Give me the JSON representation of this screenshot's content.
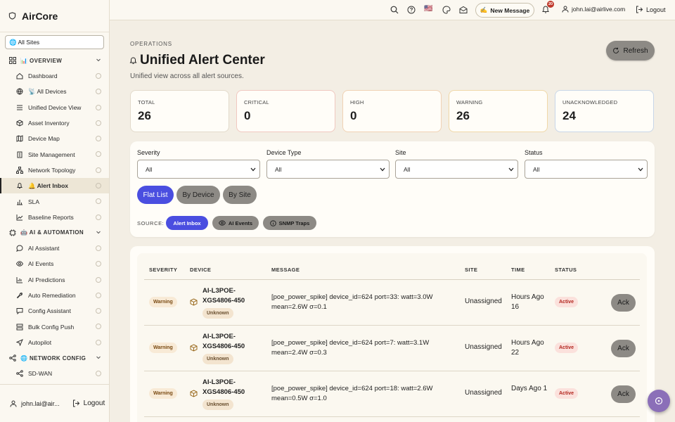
{
  "app": {
    "name": "AirCore"
  },
  "sidebar": {
    "site_selector": "🌐 All Sites",
    "sections": [
      {
        "label": "📊 OVERVIEW",
        "items": [
          "Dashboard",
          "📡 All Devices",
          "Unified Device View",
          "Asset Inventory",
          "Device Map",
          "Site Management",
          "Network Topology",
          "🔔 Alert Inbox",
          "SLA",
          "Baseline Reports"
        ]
      },
      {
        "label": "🤖 AI & AUTOMATION",
        "items": [
          "AI Assistant",
          "AI Events",
          "AI Predictions",
          "Auto Remediation",
          "Config Assistant",
          "Bulk Config Push",
          "Autopilot"
        ]
      },
      {
        "label": "🌐 NETWORK CONFIG",
        "items": [
          "SD-WAN"
        ]
      }
    ],
    "active_item": "🔔 Alert Inbox",
    "footer": {
      "user": "john.lai@air...",
      "logout": "Logout"
    }
  },
  "topbar": {
    "new_message": "New Message",
    "notif_count": "20",
    "user_email": "john.lai@airlive.com",
    "logout": "Logout",
    "flag": "🇺🇸"
  },
  "page": {
    "breadcrumb": "OPERATIONS",
    "title": "Unified Alert Center",
    "subtitle": "Unified view across all alert sources.",
    "refresh": "Refresh"
  },
  "stats": [
    {
      "label": "TOTAL",
      "value": "26"
    },
    {
      "label": "CRITICAL",
      "value": "0"
    },
    {
      "label": "HIGH",
      "value": "0"
    },
    {
      "label": "WARNING",
      "value": "26"
    },
    {
      "label": "UNACKNOWLEDGED",
      "value": "24"
    }
  ],
  "filters": {
    "severity": {
      "label": "Severity",
      "value": "All"
    },
    "device_type": {
      "label": "Device Type",
      "value": "All"
    },
    "site": {
      "label": "Site",
      "value": "All"
    },
    "status": {
      "label": "Status",
      "value": "All"
    }
  },
  "views": [
    "Flat List",
    "By Device",
    "By Site"
  ],
  "source": {
    "label": "SOURCE:",
    "chips": [
      "Alert Inbox",
      "AI Events",
      "SNMP Traps"
    ]
  },
  "table": {
    "headers": [
      "SEVERITY",
      "DEVICE",
      "MESSAGE",
      "SITE",
      "TIME",
      "STATUS"
    ],
    "rows": [
      {
        "severity": "Warning",
        "device": "AI-L3POE-XGS4806-450",
        "device_tag": "Unknown",
        "message": "[poe_power_spike] device_id=624 port=33: watt=3.0W mean=2.6W σ=0.1",
        "site": "Unassigned",
        "time": "Hours Ago 16",
        "status": "Active",
        "action": "Ack"
      },
      {
        "severity": "Warning",
        "device": "AI-L3POE-XGS4806-450",
        "device_tag": "Unknown",
        "message": "[poe_power_spike] device_id=624 port=7: watt=3.1W mean=2.4W σ=0.3",
        "site": "Unassigned",
        "time": "Hours Ago 22",
        "status": "Active",
        "action": "Ack"
      },
      {
        "severity": "Warning",
        "device": "AI-L3POE-XGS4806-450",
        "device_tag": "Unknown",
        "message": "[poe_power_spike] device_id=624 port=18: watt=2.6W mean=0.5W σ=1.0",
        "site": "Unassigned",
        "time": "Days Ago 1",
        "status": "Active",
        "action": "Ack"
      }
    ]
  }
}
